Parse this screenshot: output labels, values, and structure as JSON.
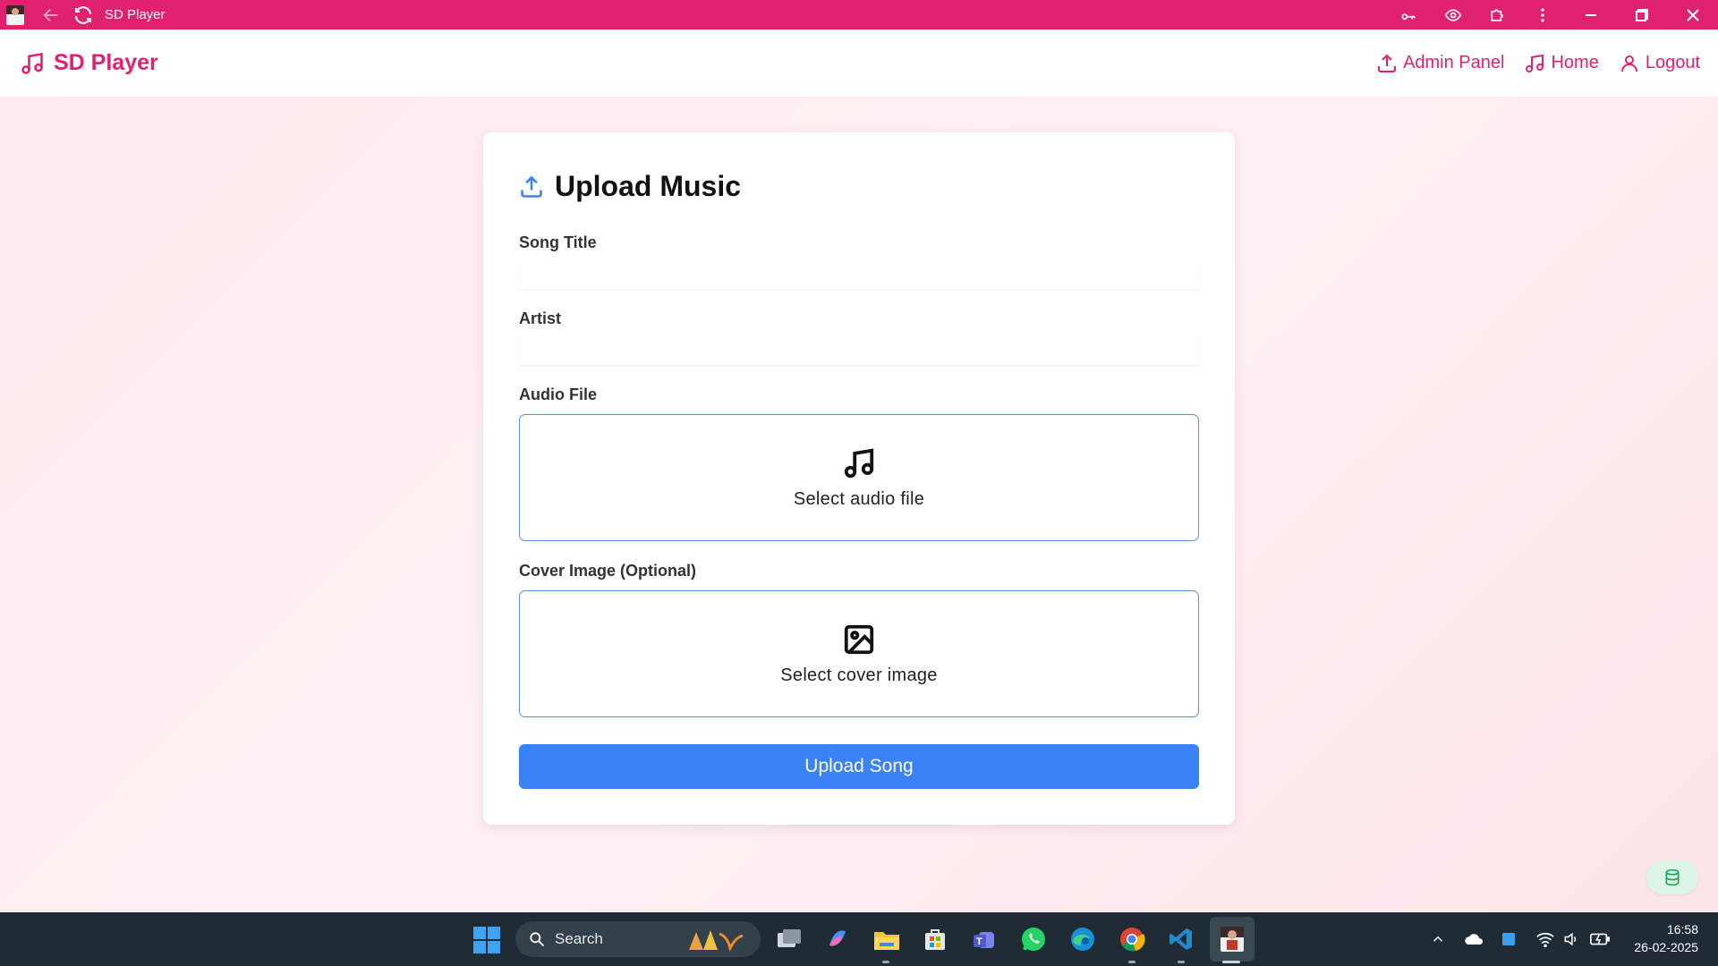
{
  "window": {
    "title": "SD Player"
  },
  "header": {
    "brand": "SD Player",
    "nav": [
      {
        "label": "Admin Panel",
        "icon": "upload-icon"
      },
      {
        "label": "Home",
        "icon": "music-note-icon"
      },
      {
        "label": "Logout",
        "icon": "user-icon"
      }
    ]
  },
  "form": {
    "title": "Upload Music",
    "song_title_label": "Song Title",
    "song_title_value": "",
    "artist_label": "Artist",
    "artist_value": "",
    "audio_label": "Audio File",
    "audio_dropzone": "Select audio file",
    "cover_label": "Cover Image (Optional)",
    "cover_dropzone": "Select cover image",
    "submit_label": "Upload Song"
  },
  "taskbar": {
    "search_placeholder": "Search",
    "time": "16:58",
    "date": "26-02-2025"
  },
  "colors": {
    "brand": "#e0226e",
    "accent": "#3b82f6",
    "taskbar": "#1f2c36"
  }
}
